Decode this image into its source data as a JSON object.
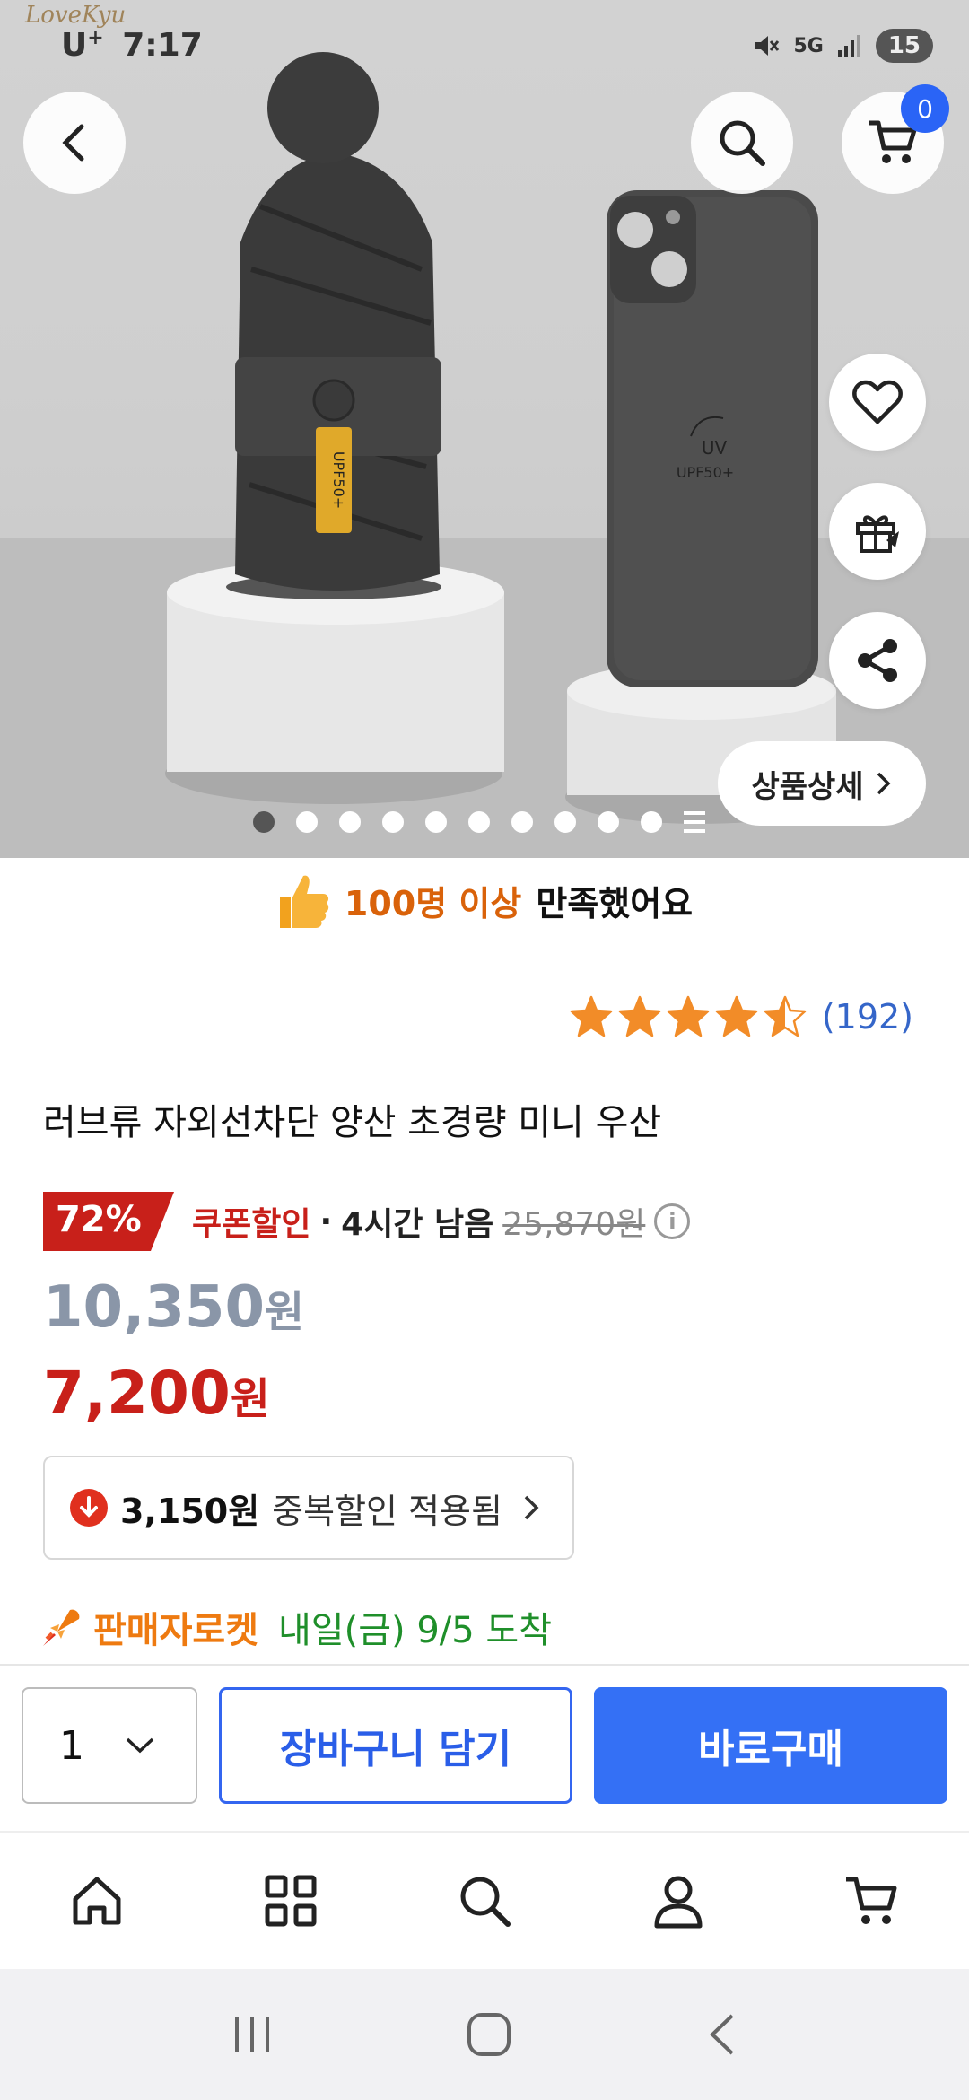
{
  "status_bar": {
    "watermark": "LoveKyu",
    "carrier": "U",
    "carrier_sup": "+",
    "time": "7:17",
    "network": "5G",
    "battery": "15"
  },
  "hero": {
    "cart_count": "0",
    "detail_label": "상품상세",
    "slide_dots_total": 10,
    "slide_dots_active": 1,
    "product_tag": "UPF50+",
    "phone_logo_1": "UV",
    "phone_logo_2": "UPF50+"
  },
  "satisfaction": {
    "highlight": "100명 이상",
    "rest": "만족했어요"
  },
  "rating": {
    "stars": 4.5,
    "count": "(192)"
  },
  "product": {
    "title": "러브류 자외선차단 양산 초경량 미니 우산"
  },
  "coupon": {
    "percent": "72%",
    "label": "쿠폰할인",
    "separator": "·",
    "remaining": "4시간 남음",
    "original_price": "25,870원",
    "info_icon": "i"
  },
  "prices": {
    "sale_amount": "10,350",
    "sale_unit": "원",
    "final_amount": "7,200",
    "final_unit": "원"
  },
  "duplicate_discount": {
    "amount": "3,150원",
    "text": "중복할인 적용됨"
  },
  "delivery": {
    "badge": "판매자로켓",
    "date": "내일(금) 9/5 도착"
  },
  "purchase_bar": {
    "quantity": "1",
    "add_to_cart": "장바구니 담기",
    "buy_now": "바로구매"
  },
  "colors": {
    "accent_blue": "#3470f5",
    "price_red": "#c8201a",
    "delivery_green": "#1f8f2a",
    "rocket_orange": "#ee7a10"
  }
}
